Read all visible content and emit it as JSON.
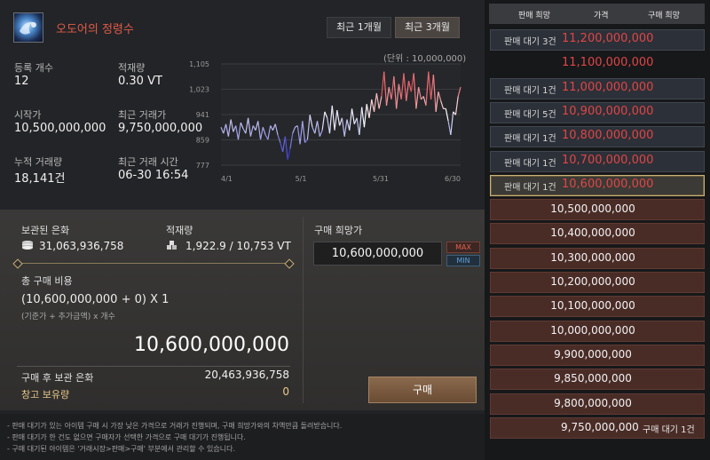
{
  "item": {
    "name": "오도어의 정령수",
    "icon": "spirit-orb-icon"
  },
  "period_buttons": [
    "최근 1개월",
    "최근 3개월"
  ],
  "stats": {
    "reg_count_label": "등록 개수",
    "reg_count": "12",
    "stock_label": "적재량",
    "stock": "0.30 VT",
    "start_price_label": "시작가",
    "start_price": "10,500,000,000",
    "last_trade_label": "최근 거래가",
    "last_trade": "9,750,000,000",
    "total_volume_label": "누적 거래량",
    "total_volume": "18,141건",
    "last_time_label": "최근 거래 시간",
    "last_time": "06-30 16:54"
  },
  "chart_data": {
    "type": "line",
    "unit_label": "(단위 : 10,000,000)",
    "y_ticks": [
      "1,105",
      "1,023",
      "941",
      "859",
      "777"
    ],
    "ylim": [
      777,
      1105
    ],
    "x_ticks": [
      "4/1",
      "5/1",
      "5/31",
      "6/30"
    ],
    "grid": true,
    "colors": {
      "high": "#e02a36",
      "low": "#3a3ad0",
      "mid": "#ffffff"
    },
    "series": [
      {
        "values": [
          900,
          880,
          910,
          870,
          925,
          885,
          905,
          860,
          915,
          895,
          880,
          930,
          870,
          905,
          890,
          920,
          860,
          900,
          875,
          860,
          905,
          890,
          910,
          875,
          850,
          820,
          870,
          795,
          830,
          880,
          900,
          905,
          845,
          920,
          850,
          860,
          940,
          900,
          880,
          920,
          870,
          890,
          950,
          930,
          880,
          970,
          890,
          955,
          905,
          930,
          870,
          925,
          890,
          960,
          910,
          930,
          875,
          965,
          900,
          975,
          930,
          990,
          950,
          1010,
          960,
          1000,
          1080,
          970,
          1030,
          990,
          1065,
          960,
          1040,
          990,
          1075,
          985,
          1050,
          1015,
          1075,
          960,
          1030,
          990,
          1000,
          970,
          1080,
          990,
          1070,
          950,
          1015,
          985,
          960,
          960,
          920,
          875,
          950,
          940,
          1000,
          1030
        ]
      }
    ]
  },
  "purchase": {
    "storage_label": "보관된 은화",
    "storage_value": "31,063,936,758",
    "capacity_label": "적재량",
    "capacity_value": "1,922.9 / 10,753 VT",
    "total_cost_label": "총 구매 비용",
    "formula": "(10,600,000,000 + 0) X 1",
    "formula_note": "(기준가 + 추가금액) x 개수",
    "total_amount": "10,600,000,000",
    "after_label": "구매 후 보관 은화",
    "after_value": "20,463,936,758",
    "warehouse_label": "창고 보유량",
    "warehouse_value": "0",
    "desired_price_label": "구매 희망가",
    "desired_price": "10,600,000,000",
    "max_label": "MAX",
    "min_label": "MIN",
    "buy_label": "구매"
  },
  "notes": [
    "- 판매 대기가 있는 아이템 구매 시 가장 낮은 가격으로 거래가 진행되며, 구매 희망가와의 차액만큼 돌려받습니다.",
    "- 판매 대기가 한 건도 없으면 구매자가 선택한 가격으로 구매 대기가 진행됩니다.",
    "- 구매 대기된 아이템은 '거래시장>판매>구매' 부분에서 관리할 수 있습니다."
  ],
  "orderbook": {
    "headers": [
      "판매 희망",
      "가격",
      "구매 희망"
    ],
    "rows": [
      {
        "type": "sell",
        "wait": "판매 대기 3건",
        "price": "11,200,000,000"
      },
      {
        "type": "sell",
        "wait": "",
        "price": "11,100,000,000"
      },
      {
        "type": "sell",
        "wait": "판매 대기 1건",
        "price": "11,000,000,000"
      },
      {
        "type": "sell",
        "wait": "판매 대기 5건",
        "price": "10,900,000,000"
      },
      {
        "type": "sell",
        "wait": "판매 대기 1건",
        "price": "10,800,000,000"
      },
      {
        "type": "sell",
        "wait": "판매 대기 1건",
        "price": "10,700,000,000"
      },
      {
        "type": "sell",
        "wait": "판매 대기 1건",
        "price": "10,600,000,000",
        "selected": true
      },
      {
        "type": "buy",
        "wait": "",
        "price": "10,500,000,000"
      },
      {
        "type": "buy",
        "wait": "",
        "price": "10,400,000,000"
      },
      {
        "type": "buy",
        "wait": "",
        "price": "10,300,000,000"
      },
      {
        "type": "buy",
        "wait": "",
        "price": "10,200,000,000"
      },
      {
        "type": "buy",
        "wait": "",
        "price": "10,100,000,000"
      },
      {
        "type": "buy",
        "wait": "",
        "price": "10,000,000,000"
      },
      {
        "type": "buy",
        "wait": "",
        "price": "9,900,000,000"
      },
      {
        "type": "buy",
        "wait": "",
        "price": "9,850,000,000"
      },
      {
        "type": "buy",
        "wait": "",
        "price": "9,800,000,000"
      },
      {
        "type": "buy",
        "wait": "구매 대기 1건",
        "price": "9,750,000,000"
      }
    ]
  }
}
